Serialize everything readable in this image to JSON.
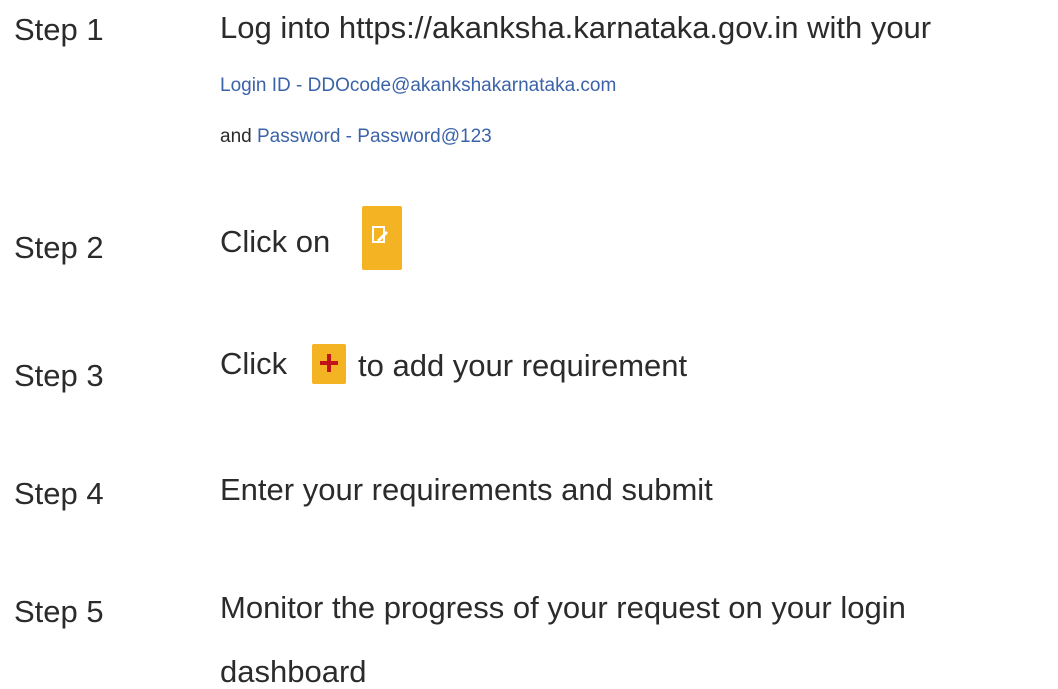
{
  "steps": [
    {
      "label": "Step 1",
      "text": "Log into  https://akanksha.karnataka.gov.in with your",
      "login_label": "Login ID - DDOcode@akankshakarnataka.com",
      "and_word": "and",
      "password_label": "Password - Password@123"
    },
    {
      "label": "Step 2",
      "text": "Click on",
      "icon": "edit-icon"
    },
    {
      "label": "Step 3",
      "text_before": "Click",
      "icon": "plus-icon",
      "text_after": "to add your requirement"
    },
    {
      "label": "Step 4",
      "text": "Enter your requirements and submit"
    },
    {
      "label": "Step 5",
      "text_line1": "Monitor the progress of your request on your login",
      "text_line2": "dashboard"
    }
  ],
  "colors": {
    "text": "#2b2b2b",
    "link_blue": "#3b63a8",
    "icon_yellow": "#f4b322"
  }
}
